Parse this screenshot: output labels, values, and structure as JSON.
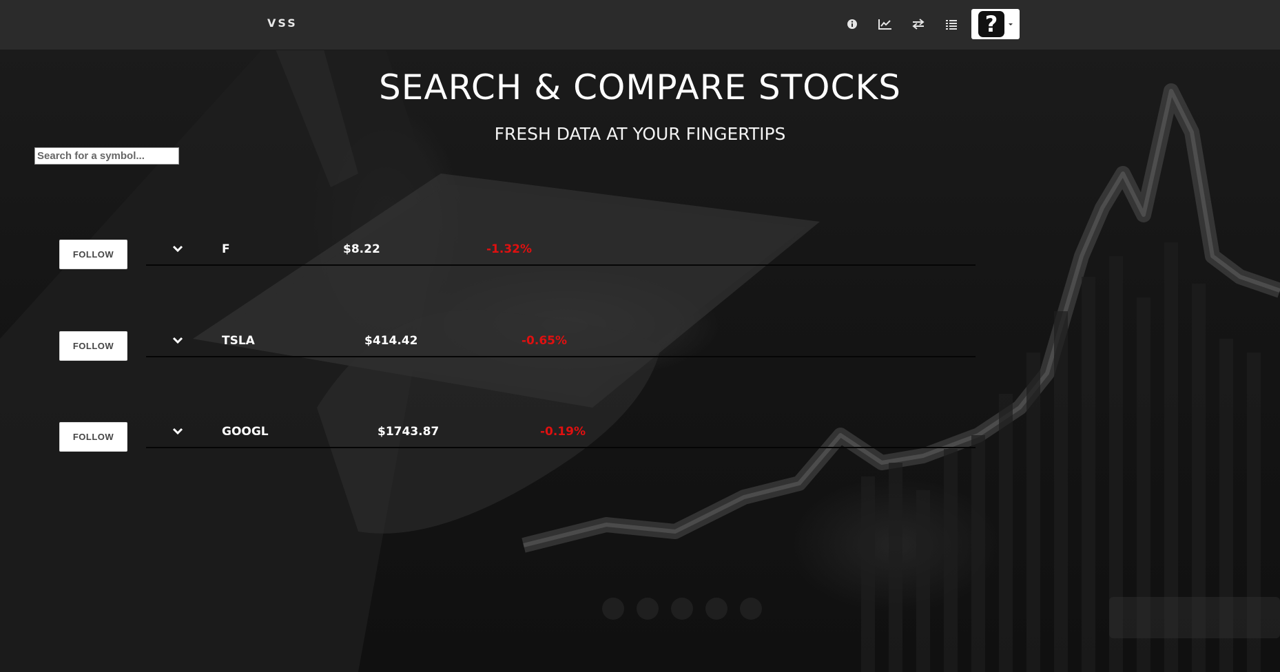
{
  "navbar": {
    "brand": "VSS",
    "icons": [
      "info-icon",
      "line-chart-icon",
      "exchange-icon",
      "list-icon"
    ],
    "user_avatar_glyph": "?"
  },
  "header": {
    "title": "SEARCH & COMPARE STOCKS",
    "subtitle": "FRESH DATA AT YOUR FINGERTIPS"
  },
  "search": {
    "placeholder": "Search for a symbol...",
    "value": ""
  },
  "stocks": [
    {
      "follow_label": "FOLLOW",
      "symbol": "F",
      "price": "$8.22",
      "change": "-1.32%"
    },
    {
      "follow_label": "FOLLOW",
      "symbol": "TSLA",
      "price": "$414.42",
      "change": "-0.65%"
    },
    {
      "follow_label": "FOLLOW",
      "symbol": "GOOGL",
      "price": "$1743.87",
      "change": "-0.19%"
    }
  ],
  "colors": {
    "navbar": "#2b2b2b",
    "negative_change": "#e01010",
    "background": "#111111"
  }
}
